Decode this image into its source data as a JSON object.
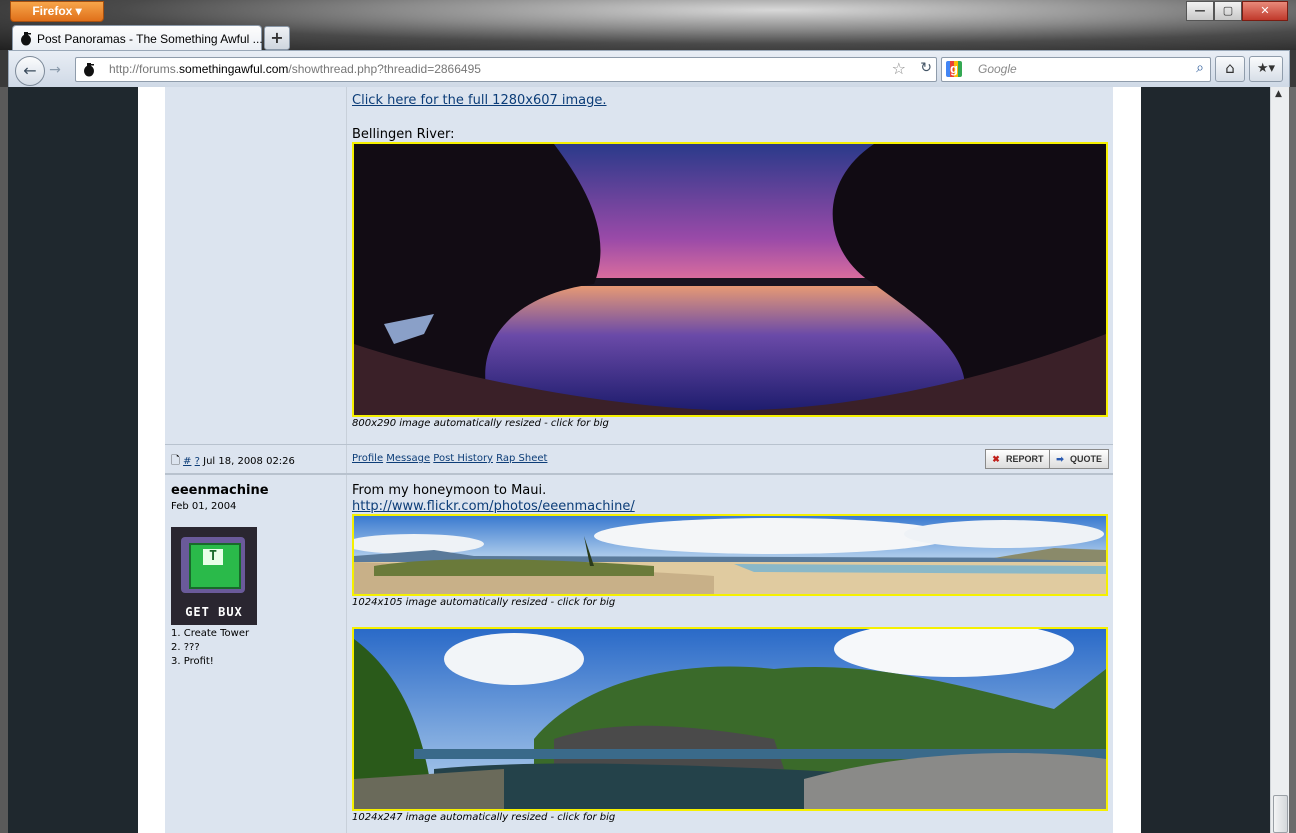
{
  "browser": {
    "menu_label": "Firefox",
    "tab_title": "Post Panoramas - The Something Awful ...",
    "new_tab_label": "+",
    "url_prefix": "http://forums.",
    "url_domain": "somethingawful.com",
    "url_path": "/showthread.php?threadid=2866495",
    "search_placeholder": "Google",
    "window_controls": [
      "—",
      "▢",
      "✕"
    ]
  },
  "post1": {
    "full_image_link": "Click here for the full 1280x607 image.",
    "label": "Bellingen River:",
    "image_caption": "800x290 image automatically resized - click for big",
    "footer": {
      "hash_link": "#",
      "question_link": "?",
      "date": "Jul 18, 2008 02:26",
      "links": [
        "Profile",
        "Message",
        "Post History",
        "Rap Sheet"
      ],
      "report_label": "REPORT",
      "quote_label": "QUOTE"
    }
  },
  "post2": {
    "username": "eeenmachine",
    "regdate": "Feb 01, 2004",
    "avatar_text": "GET BUX",
    "user_title": [
      "1. Create Tower",
      "2. ???",
      "3. Profit!"
    ],
    "text": "From my honeymoon to Maui.",
    "link": "http://www.flickr.com/photos/eeenmachine/",
    "image1_caption": "1024x105 image automatically resized - click for big",
    "image2_caption": "1024x247 image automatically resized - click for big"
  },
  "colors": {
    "post_bg": "#dce4ef",
    "link": "#0c3d78",
    "image_border": "#f5f000",
    "page_side": "#1f282e"
  }
}
